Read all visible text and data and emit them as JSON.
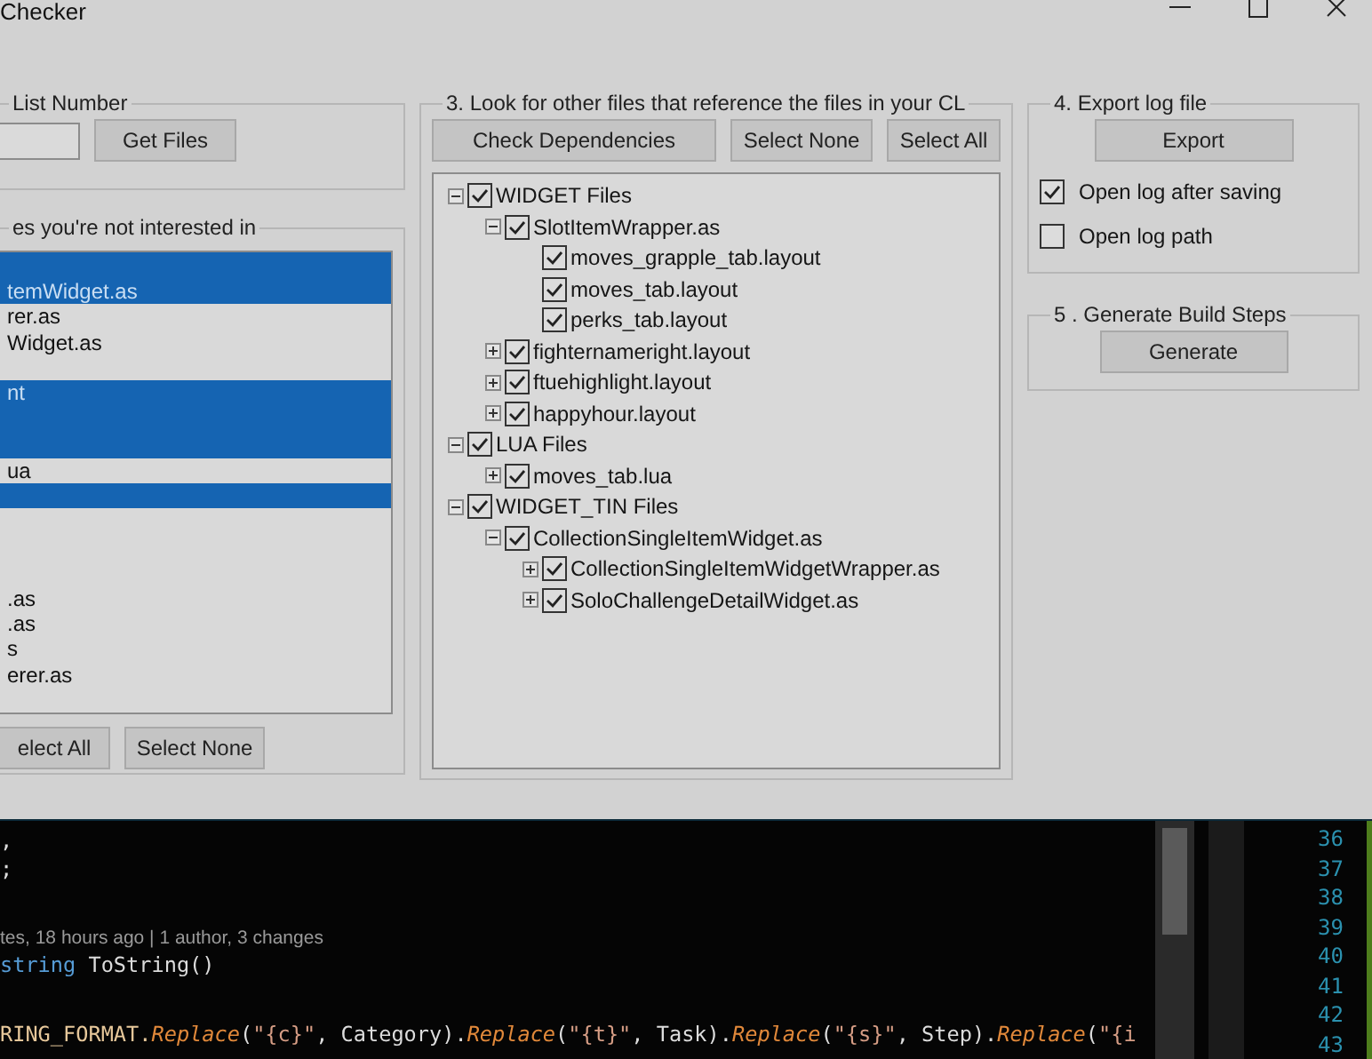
{
  "window": {
    "title": "Checker"
  },
  "list_group": {
    "title": "List Number",
    "button": "Get Files"
  },
  "files_group": {
    "title": "es you're not interested in",
    "items": [
      {
        "selected": true
      },
      {
        "text": "temWidget.as",
        "selected": true
      },
      {
        "text": "rer.as",
        "selected": false
      },
      {
        "text": "Widget.as",
        "selected": false
      },
      {
        "selected": false
      },
      {
        "text": "nt",
        "selected": true
      },
      {
        "selected": true
      },
      {
        "selected": true
      },
      {
        "text": "ua",
        "selected": false
      },
      {
        "selected": true
      },
      {
        "selected": false
      },
      {
        "selected": false
      },
      {
        "selected": false
      },
      {
        "text": ".as",
        "selected": false
      },
      {
        "text": ".as",
        "selected": false
      },
      {
        "text": "s",
        "selected": false
      },
      {
        "text": "erer.as",
        "selected": false
      }
    ],
    "buttons": [
      "elect All",
      "Select None"
    ]
  },
  "deps_group": {
    "title": "3. Look for other files that reference the files in your CL",
    "buttons": [
      "Check Dependencies",
      "Select None",
      "Select All"
    ],
    "tree": [
      {
        "label": "WIDGET Files",
        "checked": true,
        "expandable": true,
        "expanded": true,
        "children": [
          {
            "label": "SlotItemWrapper.as",
            "checked": true,
            "expandable": true,
            "expanded": true,
            "children": [
              {
                "label": "moves_grapple_tab.layout",
                "checked": true,
                "expandable": false
              },
              {
                "label": "moves_tab.layout",
                "checked": true,
                "expandable": false
              },
              {
                "label": "perks_tab.layout",
                "checked": true,
                "expandable": false
              }
            ]
          },
          {
            "label": "fighternameright.layout",
            "checked": true,
            "expandable": true,
            "expanded": false
          },
          {
            "label": "ftuehighlight.layout",
            "checked": true,
            "expandable": true,
            "expanded": false
          },
          {
            "label": "happyhour.layout",
            "checked": true,
            "expandable": true,
            "expanded": false
          }
        ]
      },
      {
        "label": "LUA Files",
        "checked": true,
        "expandable": true,
        "expanded": true,
        "children": [
          {
            "label": "moves_tab.lua",
            "checked": true,
            "expandable": true,
            "expanded": false
          }
        ]
      },
      {
        "label": "WIDGET_TIN Files",
        "checked": true,
        "expandable": true,
        "expanded": true,
        "children": [
          {
            "label": "CollectionSingleItemWidget.as",
            "checked": true,
            "expandable": true,
            "expanded": true,
            "children": [
              {
                "label": "CollectionSingleItemWidgetWrapper.as",
                "checked": true,
                "expandable": true,
                "expanded": false
              },
              {
                "label": "SoloChallengeDetailWidget.as",
                "checked": true,
                "expandable": true,
                "expanded": false
              }
            ]
          }
        ]
      }
    ]
  },
  "export_group": {
    "title": "4. Export log file",
    "button": "Export",
    "options": [
      {
        "label": "Open log after saving",
        "checked": true
      },
      {
        "label": "Open log path",
        "checked": false
      }
    ]
  },
  "generate_group": {
    "title": "5 . Generate Build Steps",
    "button": "Generate"
  },
  "editor": {
    "blocks": [
      [
        [
          {
            "text": ",",
            "kind": "plain"
          }
        ],
        [
          {
            "text": ";",
            "kind": "plain"
          }
        ]
      ],
      [
        [
          {
            "text": "tes, 18 hours ago | 1 author, 3 changes",
            "kind": "lens"
          }
        ],
        [
          {
            "text": "string",
            "kind": "keyword"
          },
          {
            "text": " ToString()",
            "kind": "plain"
          }
        ]
      ],
      [
        [
          {
            "text": "RING_FORMAT.",
            "kind": "const"
          },
          {
            "text": "Replace",
            "kind": "method"
          },
          {
            "text": "(",
            "kind": "plain"
          },
          {
            "text": "\"{c}\"",
            "kind": "string"
          },
          {
            "text": ", Category).",
            "kind": "plain"
          },
          {
            "text": "Replace",
            "kind": "method"
          },
          {
            "text": "(",
            "kind": "plain"
          },
          {
            "text": "\"{t}\"",
            "kind": "string"
          },
          {
            "text": ", Task).",
            "kind": "plain"
          },
          {
            "text": "Replace",
            "kind": "method"
          },
          {
            "text": "(",
            "kind": "plain"
          },
          {
            "text": "\"{s}\"",
            "kind": "string"
          },
          {
            "text": ", Step).",
            "kind": "plain"
          },
          {
            "text": "Replace",
            "kind": "method"
          },
          {
            "text": "(",
            "kind": "plain"
          },
          {
            "text": "\"{i",
            "kind": "string"
          }
        ]
      ]
    ],
    "line_numbers": [
      "36",
      "37",
      "38",
      "39",
      "40",
      "41",
      "42",
      "43"
    ]
  }
}
